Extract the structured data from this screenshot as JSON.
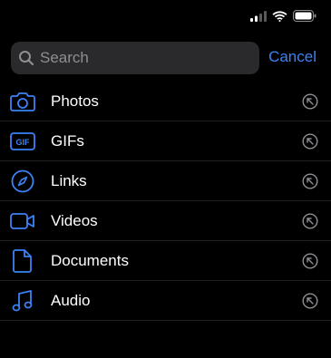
{
  "colors": {
    "background": "#000000",
    "accent": "#3b82f6",
    "search_bg": "#2a2a2c",
    "placeholder": "#8e8e93",
    "row_action": "#8e8e93"
  },
  "status_bar": {
    "icons": [
      "signal-icon",
      "wifi-icon",
      "battery-icon"
    ]
  },
  "search": {
    "placeholder": "Search",
    "value": "",
    "icon": "search-icon",
    "cancel_label": "Cancel"
  },
  "list": {
    "items": [
      {
        "label": "Photos",
        "icon": "camera-icon",
        "action_icon": "jump-arrow-icon"
      },
      {
        "label": "GIFs",
        "icon": "gif-icon",
        "action_icon": "jump-arrow-icon"
      },
      {
        "label": "Links",
        "icon": "compass-icon",
        "action_icon": "jump-arrow-icon"
      },
      {
        "label": "Videos",
        "icon": "video-icon",
        "action_icon": "jump-arrow-icon"
      },
      {
        "label": "Documents",
        "icon": "document-icon",
        "action_icon": "jump-arrow-icon"
      },
      {
        "label": "Audio",
        "icon": "music-note-icon",
        "action_icon": "jump-arrow-icon"
      }
    ]
  }
}
